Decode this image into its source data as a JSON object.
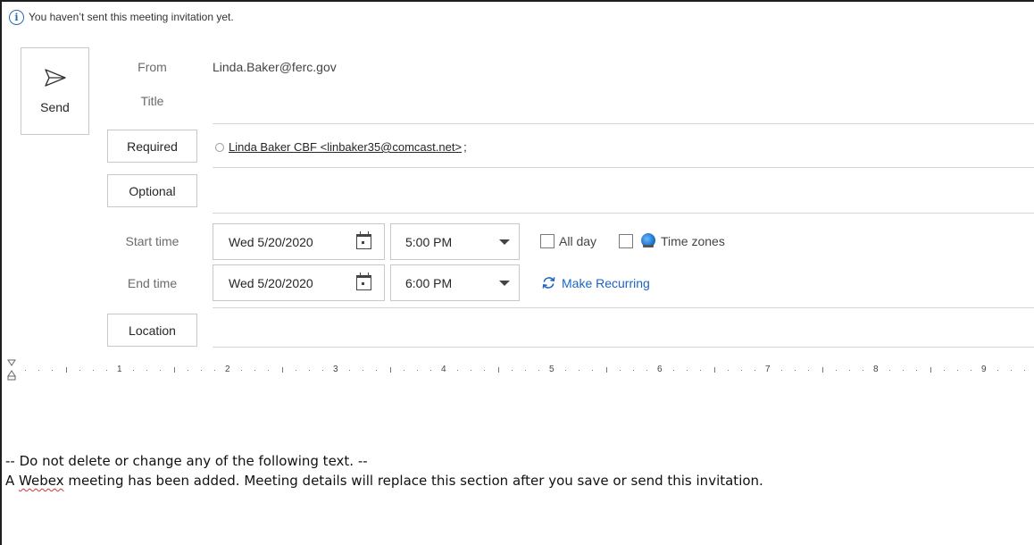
{
  "info_bar": {
    "text": "You haven’t sent this meeting invitation yet."
  },
  "send": {
    "label": "Send"
  },
  "fields": {
    "from_label": "From",
    "from_value": "Linda.Baker@ferc.gov",
    "title_label": "Title",
    "required_label": "Required",
    "required_recipient": "Linda Baker CBF <linbaker35@comcast.net>",
    "required_separator": ";",
    "optional_label": "Optional",
    "start_label": "Start time",
    "start_date": "Wed 5/20/2020",
    "start_time": "5:00 PM",
    "end_label": "End time",
    "end_date": "Wed 5/20/2020",
    "end_time": "6:00 PM",
    "all_day_label": "All day",
    "time_zones_label": "Time zones",
    "make_recurring_label": "Make Recurring",
    "location_label": "Location"
  },
  "ruler": {
    "numbers": [
      "1",
      "2",
      "3",
      "4",
      "5",
      "6",
      "7",
      "8",
      "9"
    ]
  },
  "body": {
    "line1": "-- Do not delete or change any of the following text. --",
    "line2_prefix": "A ",
    "line2_misspelled": "Webex",
    "line2_rest": " meeting has been added. Meeting details will replace this section after you save or send this invitation."
  },
  "colors": {
    "accent": "#1b64c4",
    "border": "#c8c8c8",
    "spellcheck": "#d13438"
  }
}
